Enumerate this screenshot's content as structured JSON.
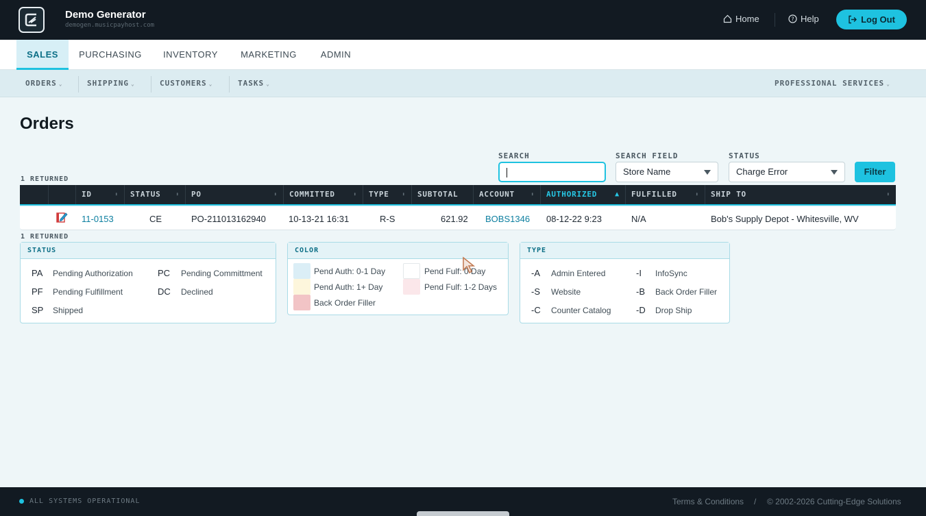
{
  "header": {
    "brand_title": "Demo Generator",
    "brand_subtitle": "demogen.musicpayhost.com",
    "home_label": "Home",
    "help_label": "Help",
    "logout_label": "Log Out",
    "accent_color": "#1ec2e0"
  },
  "main_nav": {
    "tabs": [
      {
        "label": "SALES",
        "active": true
      },
      {
        "label": "PURCHASING"
      },
      {
        "label": "INVENTORY"
      },
      {
        "label": "MARKETING"
      },
      {
        "label": "ADMIN"
      }
    ]
  },
  "sub_nav": {
    "items": [
      "ORDERS",
      "SHIPPING",
      "CUSTOMERS",
      "TASKS"
    ],
    "right_item": "PROFESSIONAL SERVICES"
  },
  "page": {
    "title": "Orders"
  },
  "filters": {
    "search_label": "SEARCH",
    "search_value": "",
    "search_field_label": "SEARCH FIELD",
    "search_field_value": "Store Name",
    "status_label": "STATUS",
    "status_value": "Charge Error",
    "filter_button": "Filter"
  },
  "returned_text": "1 RETURNED",
  "table": {
    "columns": [
      "ID",
      "STATUS",
      "PO",
      "COMMITTED",
      "TYPE",
      "SUBTOTAL",
      "ACCOUNT",
      "AUTHORIZED",
      "FULFILLED",
      "SHIP TO"
    ],
    "sorted_column": "AUTHORIZED",
    "rows": [
      {
        "id": "11-0153",
        "status": "CE",
        "po": "PO-211013162940",
        "committed": "10-13-21 16:31",
        "type": "R-S",
        "subtotal": "621.92",
        "account": "BOBS1346",
        "authorized": "08-12-22 9:23",
        "fulfilled": "N/A",
        "ship_to": "Bob's Supply Depot - Whitesville, WV"
      }
    ]
  },
  "legend": {
    "status": {
      "title": "STATUS",
      "items": [
        {
          "code": "PA",
          "text": "Pending Authorization"
        },
        {
          "code": "PC",
          "text": "Pending Committment"
        },
        {
          "code": "PF",
          "text": "Pending Fulfillment"
        },
        {
          "code": "DC",
          "text": "Declined"
        },
        {
          "code": "SP",
          "text": "Shipped"
        }
      ]
    },
    "color": {
      "title": "COLOR",
      "items": [
        {
          "text": "Pend Auth: 0-1 Day",
          "color": "#dbeef6"
        },
        {
          "text": "Pend Fulf: 0 Day",
          "color": "#ffffff"
        },
        {
          "text": "Pend Auth: 1+ Day",
          "color": "#fdf6dc"
        },
        {
          "text": "Pend Fulf: 1-2 Days",
          "color": "#fbe7ea"
        },
        {
          "text": "Back Order Filler",
          "color": "#f2c4c6"
        }
      ]
    },
    "type": {
      "title": "TYPE",
      "items": [
        {
          "code": "-A",
          "text": "Admin Entered"
        },
        {
          "code": "-I",
          "text": "InfoSync"
        },
        {
          "code": "-S",
          "text": "Website"
        },
        {
          "code": "-B",
          "text": "Back Order Filler"
        },
        {
          "code": "-C",
          "text": "Counter Catalog"
        },
        {
          "code": "-D",
          "text": "Drop Ship"
        }
      ]
    }
  },
  "footer": {
    "status": "ALL SYSTEMS OPERATIONAL",
    "terms": "Terms & Conditions",
    "separator": "/",
    "copyright": "© 2002-2026 Cutting-Edge Solutions"
  }
}
